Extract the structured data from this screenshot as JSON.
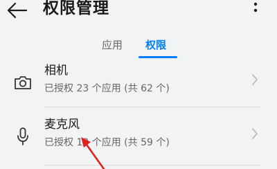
{
  "header": {
    "title": "权限管理",
    "back_icon": "arrow-left-icon",
    "more_icon": "more-vertical-icon"
  },
  "tabs": [
    {
      "label": "应用",
      "selected": false
    },
    {
      "label": "权限",
      "selected": true
    }
  ],
  "permissions": [
    {
      "icon": "camera-icon",
      "name": "相机",
      "summary": "已授权 23 个应用 (共 62 个)"
    },
    {
      "icon": "microphone-icon",
      "name": "麦克风",
      "summary": "已授权 13 个应用 (共 59 个)"
    }
  ],
  "colors": {
    "accent": "#007dff",
    "annotation_arrow": "#e02020",
    "background": "#f1f3f5"
  }
}
